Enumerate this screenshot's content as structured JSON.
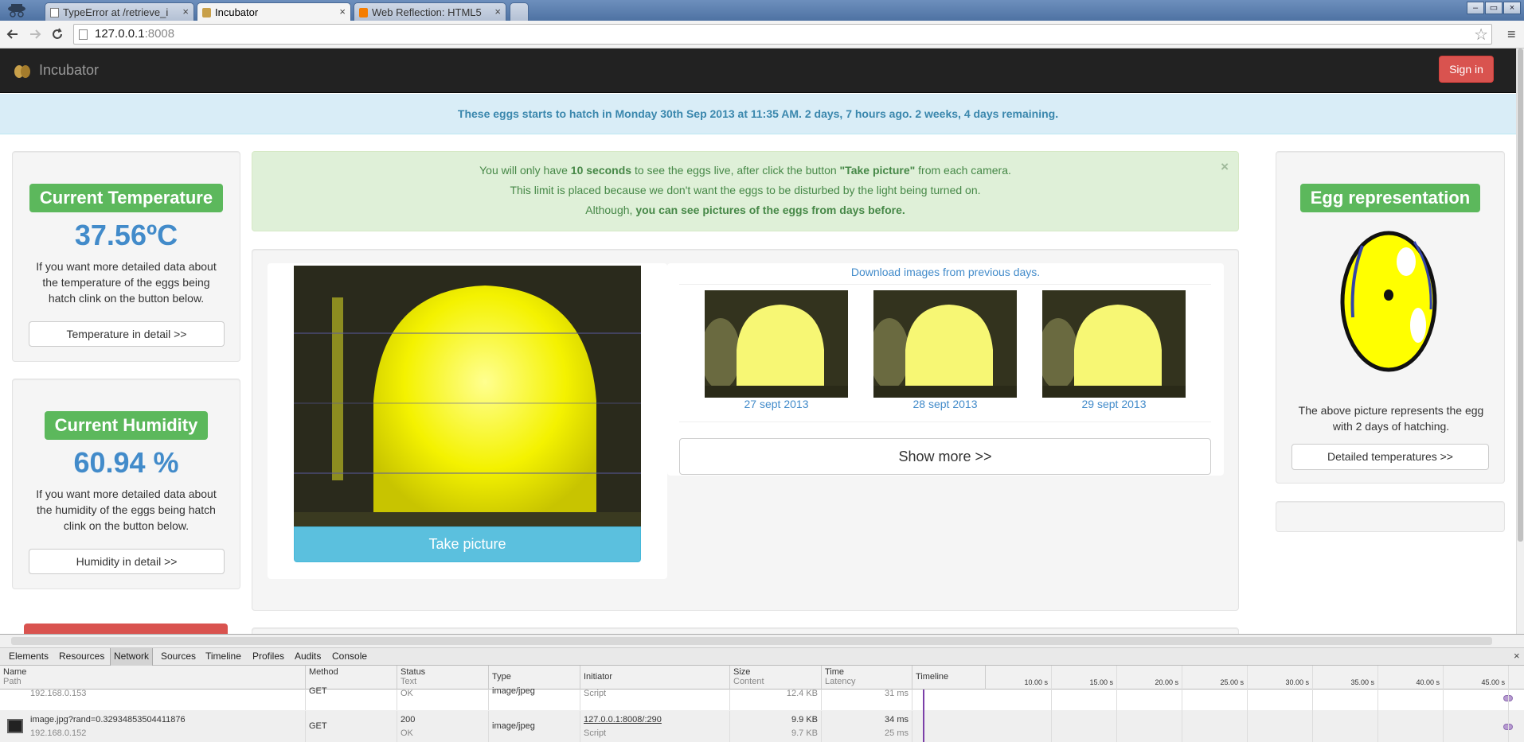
{
  "browser": {
    "tabs": [
      {
        "title": "TypeError at /retrieve_i",
        "close": "×"
      },
      {
        "title": "Incubator",
        "close": "×"
      },
      {
        "title": "Web Reflection: HTML5",
        "close": "×"
      }
    ],
    "url_host": "127.0.0.1",
    "url_port": ":8008",
    "window_controls": [
      "–",
      "▭",
      "×"
    ],
    "icons": {
      "back": "arrow-left-icon",
      "forward": "arrow-right-icon",
      "reload": "reload-icon",
      "star": "star-icon",
      "menu": "hamburger-menu-icon"
    }
  },
  "navbar": {
    "brand": "Incubator",
    "signin_label": "Sign in",
    "brand_color": "#222222",
    "signin_color": "#d9534f"
  },
  "hatch_alert": "These eggs starts to hatch in Monday 30th Sep 2013 at 11:35 AM. 2 days, 7 hours ago. 2 weeks, 4 days remaining.",
  "temperature": {
    "title": "Current Temperature",
    "value": "37.56ºC",
    "description": "If you want more detailed data about the temperature of the eggs being hatch clink on the button below.",
    "button": "Temperature in detail >>"
  },
  "humidity": {
    "title": "Current Humidity",
    "value": "60.94 %",
    "description": "If you want more detailed data about the humidity of the eggs being hatch clink on the button below.",
    "button": "Humidity in detail >>"
  },
  "info_alert": {
    "line1_pre": "You will only have ",
    "line1_bold1": "10 seconds",
    "line1_mid": " to see the eggs live, after click the button ",
    "line1_bold2": "\"Take picture\"",
    "line1_post": " from each camera.",
    "line2": "This limit is placed because we don't want the eggs to be disturbed by the light being turned on.",
    "line3_pre": "Although, ",
    "line3_bold": "you can see pictures of the eggs from days before.",
    "close": "×"
  },
  "camera": {
    "take_picture_label": "Take picture"
  },
  "previous": {
    "download_link": "Download images from previous days.",
    "thumbs": [
      {
        "caption": "27 sept 2013"
      },
      {
        "caption": "28 sept 2013"
      },
      {
        "caption": "29 sept 2013"
      }
    ],
    "show_more": "Show more >>"
  },
  "egg": {
    "title": "Egg representation",
    "description": "The above picture represents the egg with 2 days of hatching.",
    "button": "Detailed temperatures >>"
  },
  "devtools": {
    "tabs": [
      "Elements",
      "Resources",
      "Network",
      "Sources",
      "Timeline",
      "Profiles",
      "Audits",
      "Console"
    ],
    "active_tab": "Network",
    "close": "×",
    "columns": [
      {
        "name": "Name",
        "sub": "Path"
      },
      {
        "name": "Method",
        "sub": ""
      },
      {
        "name": "Status",
        "sub": "Text"
      },
      {
        "name": "Type",
        "sub": ""
      },
      {
        "name": "Initiator",
        "sub": ""
      },
      {
        "name": "Size",
        "sub": "Content"
      },
      {
        "name": "Time",
        "sub": "Latency"
      },
      {
        "name": "Timeline",
        "sub": ""
      }
    ],
    "ticks": [
      "10.00 s",
      "15.00 s",
      "20.00 s",
      "25.00 s",
      "30.00 s",
      "35.00 s",
      "40.00 s",
      "45.00 s"
    ],
    "rows": [
      {
        "name": "",
        "path": "192.168.0.153",
        "method": "GET",
        "status": "",
        "status_text": "OK",
        "type": "image/jpeg",
        "initiator": "",
        "initiator_sub": "Script",
        "size": "",
        "content": "12.4 KB",
        "time": "",
        "latency": "31 ms"
      },
      {
        "name": "image.jpg?rand=0.329348535044118​76",
        "path": "192.168.0.152",
        "method": "GET",
        "status": "200",
        "status_text": "OK",
        "type": "image/jpeg",
        "initiator": "127.0.0.1:8008/:290",
        "initiator_sub": "Script",
        "size": "9.9 KB",
        "content": "9.7 KB",
        "time": "34 ms",
        "latency": "25 ms"
      }
    ]
  }
}
